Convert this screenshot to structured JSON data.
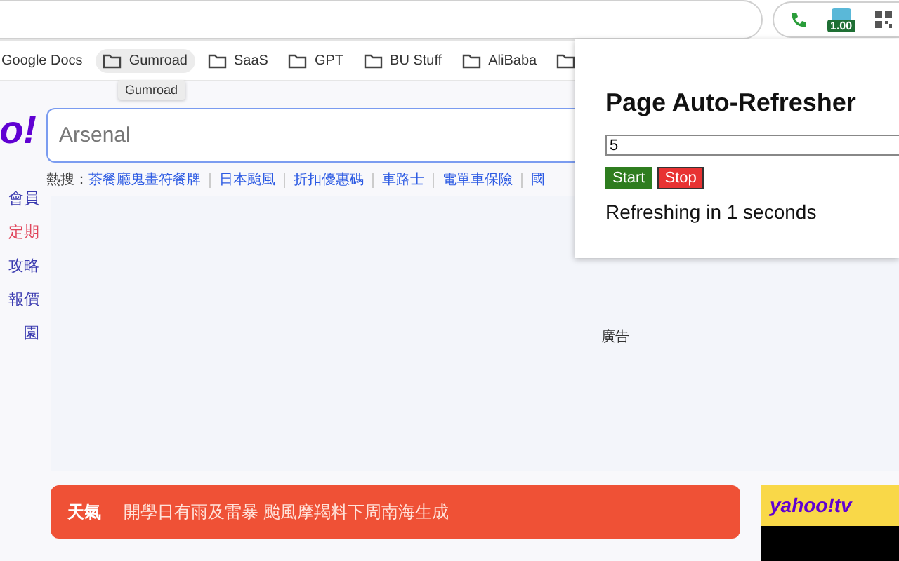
{
  "toolbar": {
    "extensions": [
      {
        "kind": "phone"
      },
      {
        "kind": "badge",
        "badge": "1.00"
      },
      {
        "kind": "qr"
      }
    ]
  },
  "bookmarks": [
    {
      "kind": "plain",
      "label": "Google Docs",
      "hovered": false
    },
    {
      "kind": "folder",
      "label": "Gumroad",
      "hovered": true
    },
    {
      "kind": "folder",
      "label": "SaaS",
      "hovered": false
    },
    {
      "kind": "folder",
      "label": "GPT",
      "hovered": false
    },
    {
      "kind": "folder",
      "label": "BU Stuff",
      "hovered": false
    },
    {
      "kind": "folder",
      "label": "AliBaba",
      "hovered": false
    },
    {
      "kind": "folder"
    }
  ],
  "tooltip": "Gumroad",
  "page": {
    "logo": "o!",
    "sidebar": [
      {
        "label": "會員",
        "highlight": false
      },
      {
        "label": "定期",
        "highlight": true
      },
      {
        "label": "攻略",
        "highlight": false
      },
      {
        "label": "報價",
        "highlight": false
      },
      {
        "label": "園",
        "highlight": false
      }
    ],
    "search": {
      "value": "Arsenal"
    },
    "hot_label": "熱搜：",
    "hot_links": [
      "茶餐廳鬼畫符餐牌",
      "日本颱風",
      "折扣優惠碼",
      "車路士",
      "電單車保險",
      "國"
    ],
    "ad_label": "廣告",
    "weather": {
      "tag": "天氣",
      "headline": "開學日有雨及雷暴 颱風摩羯料下周南海生成"
    },
    "tv_logo": "yahoo!tv"
  },
  "popup": {
    "title": "Page Auto-Refresher",
    "interval": "5",
    "buttons": [
      {
        "kind": "start",
        "label": "Start"
      },
      {
        "kind": "stop",
        "label": "Stop"
      }
    ],
    "status": "Refreshing in 1 seconds"
  }
}
